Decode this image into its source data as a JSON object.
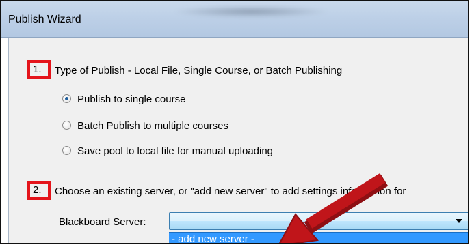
{
  "window": {
    "title": "Publish Wizard"
  },
  "step1": {
    "number": "1.",
    "text": "Type of Publish - Local File, Single Course, or Batch Publishing"
  },
  "publish_options": [
    {
      "label": "Publish to single course",
      "checked": true
    },
    {
      "label": "Batch Publish to multiple courses",
      "checked": false
    },
    {
      "label": "Save pool to local file for manual uploading",
      "checked": false
    }
  ],
  "step2": {
    "number": "2.",
    "text": "Choose an existing server, or \"add new server\" to add settings information for"
  },
  "server": {
    "label": "Blackboard Server:",
    "selected_value": "",
    "dropdown_item": "- add new server -"
  },
  "colors": {
    "highlight_box": "#e4141b",
    "annotation_arrow": "#c0151a",
    "dropdown_selection": "#3399ff"
  },
  "icons": {
    "annotation": "red-arrow-icon",
    "combo": "chevron-down-icon"
  }
}
